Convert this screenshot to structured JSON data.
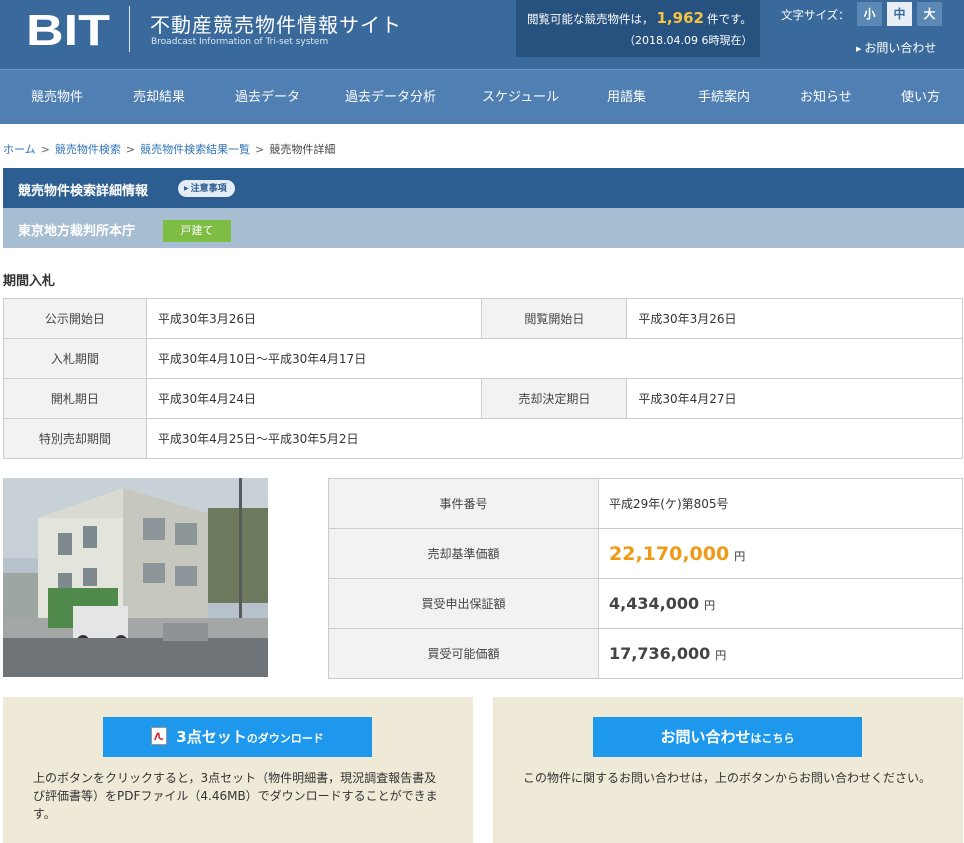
{
  "header": {
    "logo_text": "BIT",
    "title": "不動産競売物件情報サイト",
    "subtitle": "Broadcast Information of Tri-set system",
    "available_prefix": "閲覧可能な競売物件は，",
    "available_count": "1,962",
    "available_suffix": "件です。",
    "as_of": "（2018.04.09 6時現在）",
    "font_size_label": "文字サイズ：",
    "font_sizes": [
      "小",
      "中",
      "大"
    ],
    "contact_link": "お問い合わせ"
  },
  "nav": [
    "競売物件",
    "売却結果",
    "過去データ",
    "過去データ分析",
    "スケジュール",
    "用語集",
    "手続案内",
    "お知らせ",
    "使い方"
  ],
  "breadcrumb": [
    "ホーム",
    "競売物件検索",
    "競売物件検索結果一覧",
    "競売物件詳細"
  ],
  "section": {
    "title": "競売物件検索詳細情報",
    "notice_badge": "注意事項",
    "court": "東京地方裁判所本庁",
    "property_type": "戸建て"
  },
  "bidding": {
    "title": "期間入札",
    "public_start_label": "公示開始日",
    "public_start": "平成30年3月26日",
    "view_start_label": "閲覧開始日",
    "view_start": "平成30年3月26日",
    "bid_period_label": "入札期間",
    "bid_period": "平成30年4月10日～平成30年4月17日",
    "opening_label": "開札期日",
    "opening": "平成30年4月24日",
    "decision_label": "売却決定期日",
    "decision": "平成30年4月27日",
    "special_label": "特別売却期間",
    "special": "平成30年4月25日～平成30年5月2日"
  },
  "prices": {
    "case_label": "事件番号",
    "case_no": "平成29年(ケ)第805号",
    "base_label": "売却基準価額",
    "base": "22,170,000",
    "deposit_label": "買受申出保証額",
    "deposit": "4,434,000",
    "min_label": "買受可能価額",
    "min": "17,736,000",
    "yen": "円"
  },
  "download": {
    "btn_main": "3点セット",
    "btn_sub": "のダウンロード",
    "text": "上のボタンをクリックすると，3点セット（物件明細書，現況調査報告書及び評価書等）をPDFファイル（4.46MB）でダウンロードすることができます。"
  },
  "contact": {
    "btn_main": "お問い合わせ",
    "btn_sub": "はこちら",
    "text": "この物件に関するお問い合わせは，上のボタンからお問い合わせください。"
  },
  "colors": {
    "header_bg": "#3a6a9c",
    "nav_bg": "#4f7fb3",
    "section_bg": "#2d5e92",
    "court_bg": "#a7bdd2",
    "accent_orange": "#ef9a16",
    "button_blue": "#1e98ec",
    "type_badge_green": "#7dbd44",
    "box_bg": "#efe9d8"
  }
}
